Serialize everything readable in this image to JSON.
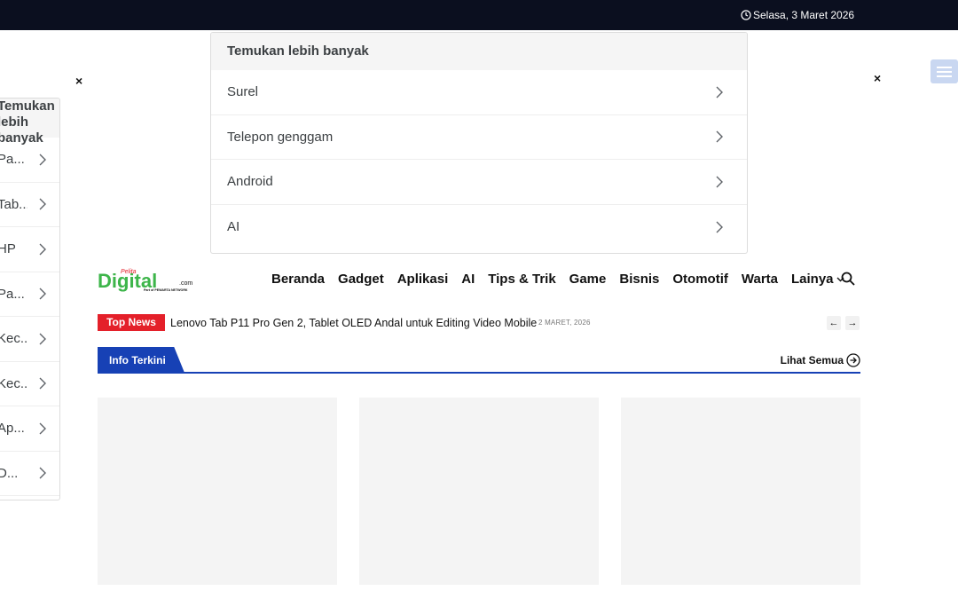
{
  "topbar": {
    "date": "Selasa, 3 Maret 2026"
  },
  "popup": {
    "title": "Temukan lebih banyak",
    "items": [
      "Surel",
      "Telepon genggam",
      "Android",
      "AI"
    ]
  },
  "side_panel": {
    "title": "Temukan lebih banyak",
    "items": [
      "Pa...",
      "Tab...",
      "HP",
      "Pa...",
      "Kec...",
      "Kec...",
      "Ap...",
      "D..."
    ]
  },
  "close_label": "×",
  "logo": {
    "brand": "Digital",
    "prefix": "Pelita",
    "suffix": ".com",
    "tagline": "Part of PEWARTA NETWORK"
  },
  "nav": {
    "items": [
      "Beranda",
      "Gadget",
      "Aplikasi",
      "AI",
      "Tips & Trik",
      "Game",
      "Bisnis",
      "Otomotif",
      "Warta"
    ],
    "more": "Lainya"
  },
  "ticker": {
    "badge": "Top News",
    "headline": "Lenovo Tab P11 Pro Gen 2, Tablet OLED Andal untuk Editing Video Mobile",
    "date": "2 MARET, 2026"
  },
  "section": {
    "title": "Info Terkini",
    "see_all": "Lihat Semua"
  },
  "colors": {
    "topbar": "#0b0f1f",
    "accent_blue": "#1741b5",
    "badge_red": "#e4202a",
    "logo_green": "#3db54a",
    "logo_red": "#e4202a"
  }
}
